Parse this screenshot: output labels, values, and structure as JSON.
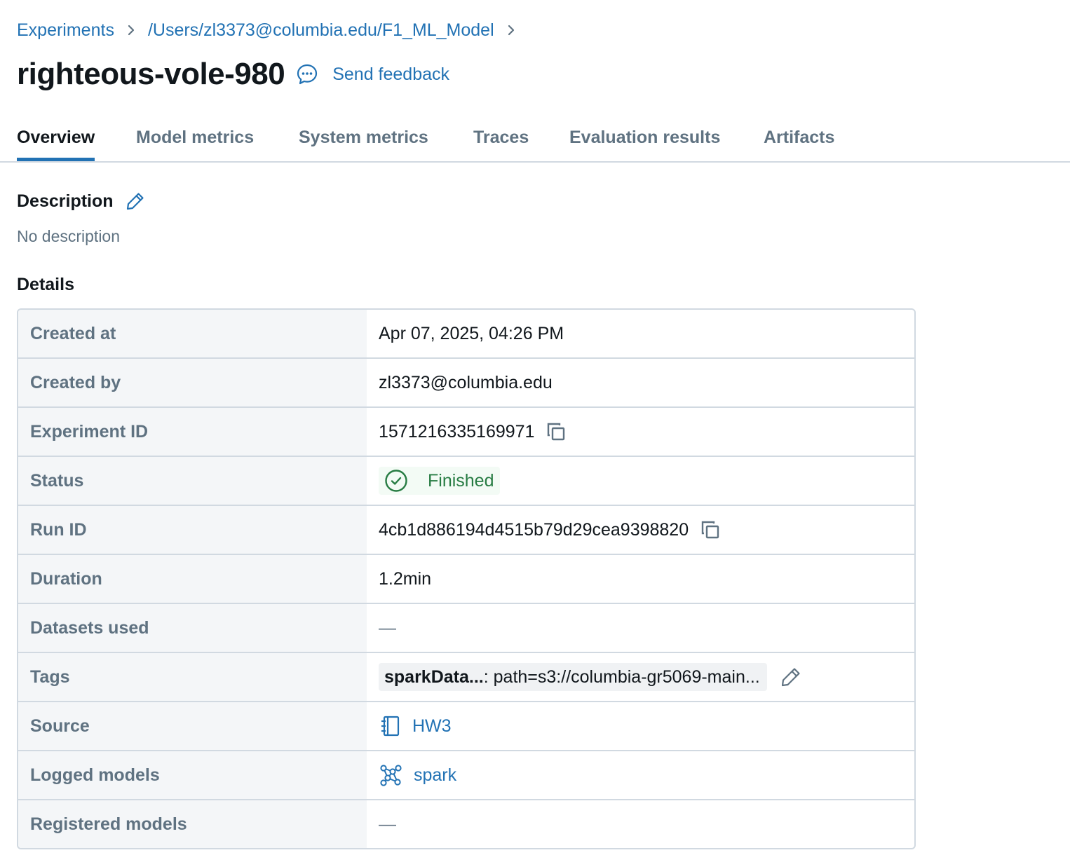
{
  "breadcrumb": {
    "items": [
      "Experiments",
      "/Users/zl3373@columbia.edu/F1_ML_Model"
    ]
  },
  "run": {
    "title": "righteous-vole-980",
    "feedback_label": "Send feedback"
  },
  "tabs": [
    {
      "label": "Overview",
      "active": true
    },
    {
      "label": "Model metrics"
    },
    {
      "label": "System metrics"
    },
    {
      "label": "Traces"
    },
    {
      "label": "Evaluation results"
    },
    {
      "label": "Artifacts"
    }
  ],
  "description": {
    "heading": "Description",
    "text": "No description"
  },
  "details": {
    "heading": "Details",
    "rows": [
      {
        "label": "Created at",
        "value": "Apr 07, 2025, 04:26 PM"
      },
      {
        "label": "Created by",
        "value": "zl3373@columbia.edu"
      },
      {
        "label": "Experiment ID",
        "value": "1571216335169971"
      },
      {
        "label": "Status",
        "value": "Finished"
      },
      {
        "label": "Run ID",
        "value": "4cb1d886194d4515b79d29cea9398820"
      },
      {
        "label": "Duration",
        "value": "1.2min"
      },
      {
        "label": "Datasets used",
        "value": "—"
      },
      {
        "label": "Tags",
        "tag_key": "sparkData...",
        "tag_value": ": path=s3://columbia-gr5069-main..."
      },
      {
        "label": "Source",
        "value": "HW3"
      },
      {
        "label": "Logged models",
        "value": "spark"
      },
      {
        "label": "Registered models",
        "value": "—"
      }
    ]
  },
  "icons": {
    "breadcrumb_separator": "chevron-right-icon",
    "feedback": "speech-bubble-icon",
    "description_edit": "pencil-icon",
    "copy": "copy-icon",
    "status": "check-circle-icon",
    "tag_edit": "pencil-icon",
    "source": "notebook-icon",
    "model": "model-graph-icon"
  },
  "colors": {
    "link": "#2272b4",
    "text": "#11171c",
    "muted": "#5f7281",
    "border": "#d1d9e1",
    "success": "#277c43",
    "success_bg": "#f3fbf5",
    "label_bg": "#f4f6f8"
  }
}
